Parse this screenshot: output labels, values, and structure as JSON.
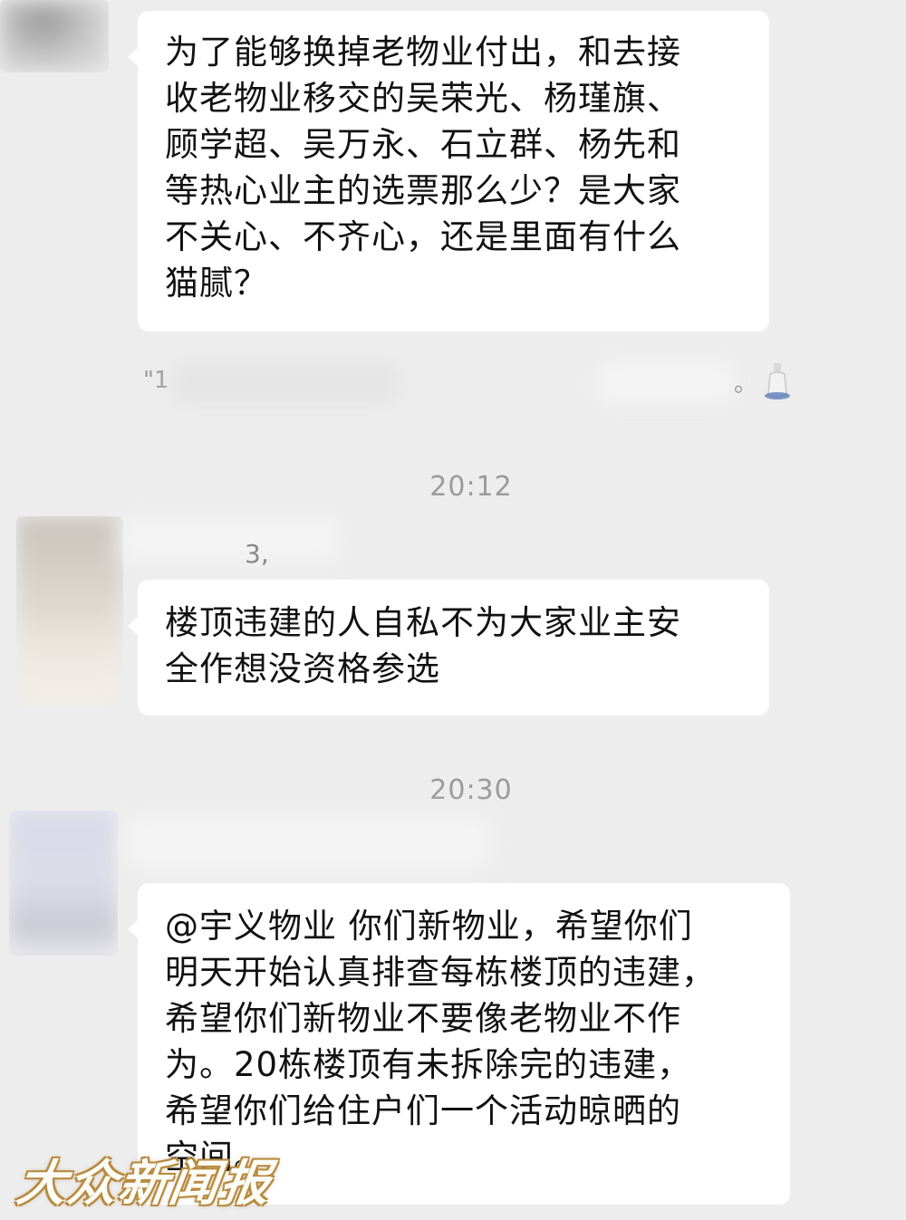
{
  "messages": [
    {
      "text": "为了能够换掉老物业付出，和去接\n收老物业移交的吴荣光、杨瑾旗、\n顾学超、吴万永、石立群、杨先和\n等热心业主的选票那么少？是大家\n不关心、不齐心，还是里面有什么\n猫腻？"
    },
    {
      "quote_open": "\"1",
      "quote_close": "。"
    },
    {
      "timestamp": "20:12"
    },
    {
      "sender_fragment": "3,",
      "text": "楼顶违建的人自私不为大家业主安\n全作想没资格参选"
    },
    {
      "timestamp": "20:30"
    },
    {
      "text": "@宇义物业 你们新物业，希望你们\n明天开始认真排查每栋楼顶的违建，\n希望你们新物业不要像老物业不作\n为。20栋楼顶有未拆除完的违建，\n希望你们给住户们一个活动晾晒的\n空间。"
    }
  ],
  "watermark": "大众新闻报",
  "colors": {
    "background": "#ededed",
    "bubble": "#ffffff",
    "timestamp": "#9a9a9a",
    "watermark_outline": "#b88a3e"
  }
}
